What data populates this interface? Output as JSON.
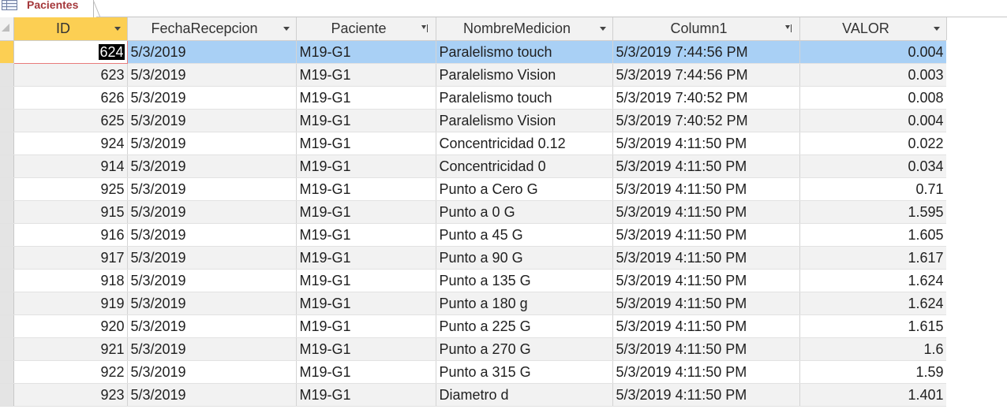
{
  "tab": {
    "label": "Pacientes"
  },
  "columns": [
    {
      "label": "ID",
      "marker": "dropdown"
    },
    {
      "label": "FechaRecepcion",
      "marker": "dropdown"
    },
    {
      "label": "Paciente",
      "marker": "filter"
    },
    {
      "label": "NombreMedicion",
      "marker": "dropdown"
    },
    {
      "label": "Column1",
      "marker": "filter"
    },
    {
      "label": "VALOR",
      "marker": "dropdown"
    }
  ],
  "rows": [
    {
      "id": "624",
      "fecha": "5/3/2019",
      "paciente": "M19-G1",
      "medicion": "Paralelismo touch",
      "column1": "5/3/2019 7:44:56 PM",
      "valor": "0.004"
    },
    {
      "id": "623",
      "fecha": "5/3/2019",
      "paciente": "M19-G1",
      "medicion": "Paralelismo Vision",
      "column1": "5/3/2019 7:44:56 PM",
      "valor": "0.003"
    },
    {
      "id": "626",
      "fecha": "5/3/2019",
      "paciente": "M19-G1",
      "medicion": "Paralelismo touch",
      "column1": "5/3/2019 7:40:52 PM",
      "valor": "0.008"
    },
    {
      "id": "625",
      "fecha": "5/3/2019",
      "paciente": "M19-G1",
      "medicion": "Paralelismo Vision",
      "column1": "5/3/2019 7:40:52 PM",
      "valor": "0.004"
    },
    {
      "id": "924",
      "fecha": "5/3/2019",
      "paciente": "M19-G1",
      "medicion": "Concentricidad 0.12",
      "column1": "5/3/2019 4:11:50 PM",
      "valor": "0.022"
    },
    {
      "id": "914",
      "fecha": "5/3/2019",
      "paciente": "M19-G1",
      "medicion": "Concentricidad 0",
      "column1": "5/3/2019 4:11:50 PM",
      "valor": "0.034"
    },
    {
      "id": "925",
      "fecha": "5/3/2019",
      "paciente": "M19-G1",
      "medicion": "Punto a Cero G",
      "column1": "5/3/2019 4:11:50 PM",
      "valor": "0.71"
    },
    {
      "id": "915",
      "fecha": "5/3/2019",
      "paciente": "M19-G1",
      "medicion": "Punto a 0 G",
      "column1": "5/3/2019 4:11:50 PM",
      "valor": "1.595"
    },
    {
      "id": "916",
      "fecha": "5/3/2019",
      "paciente": "M19-G1",
      "medicion": "Punto a 45 G",
      "column1": "5/3/2019 4:11:50 PM",
      "valor": "1.605"
    },
    {
      "id": "917",
      "fecha": "5/3/2019",
      "paciente": "M19-G1",
      "medicion": "Punto a 90 G",
      "column1": "5/3/2019 4:11:50 PM",
      "valor": "1.617"
    },
    {
      "id": "918",
      "fecha": "5/3/2019",
      "paciente": "M19-G1",
      "medicion": "Punto a 135 G",
      "column1": "5/3/2019 4:11:50 PM",
      "valor": "1.624"
    },
    {
      "id": "919",
      "fecha": "5/3/2019",
      "paciente": "M19-G1",
      "medicion": "Punto a 180 g",
      "column1": "5/3/2019 4:11:50 PM",
      "valor": "1.624"
    },
    {
      "id": "920",
      "fecha": "5/3/2019",
      "paciente": "M19-G1",
      "medicion": "Punto a 225 G",
      "column1": "5/3/2019 4:11:50 PM",
      "valor": "1.615"
    },
    {
      "id": "921",
      "fecha": "5/3/2019",
      "paciente": "M19-G1",
      "medicion": "Punto a 270 G",
      "column1": "5/3/2019 4:11:50 PM",
      "valor": "1.6"
    },
    {
      "id": "922",
      "fecha": "5/3/2019",
      "paciente": "M19-G1",
      "medicion": "Punto a 315 G",
      "column1": "5/3/2019 4:11:50 PM",
      "valor": "1.59"
    },
    {
      "id": "923",
      "fecha": "5/3/2019",
      "paciente": "M19-G1",
      "medicion": "Diametro d",
      "column1": "5/3/2019 4:11:50 PM",
      "valor": "1.401"
    }
  ],
  "selected_row": 0,
  "colors": {
    "selected_header": "#fccf53",
    "selected_row": "#a9d0f5",
    "tab_text": "#a4373a",
    "cell_focus_border": "#e87b7b"
  },
  "icons": {
    "tab_icon": "table-icon",
    "dropdown": "chevron-down-icon",
    "filter": "filter-icon"
  }
}
